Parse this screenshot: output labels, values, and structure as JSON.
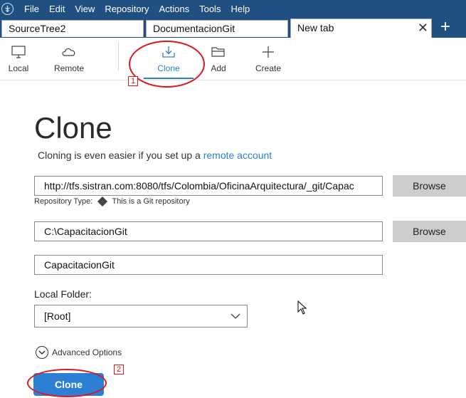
{
  "menu": {
    "items": [
      "File",
      "Edit",
      "View",
      "Repository",
      "Actions",
      "Tools",
      "Help"
    ]
  },
  "tabs": [
    {
      "label": "SourceTree2"
    },
    {
      "label": "DocumentacionGit"
    },
    {
      "label": "New tab",
      "close": "✕"
    }
  ],
  "new_tab_symbol": "+",
  "toolbar": {
    "local": "Local",
    "remote": "Remote",
    "clone": "Clone",
    "add": "Add",
    "create": "Create"
  },
  "annotations": {
    "one": "1",
    "two": "2",
    "color": "#e0161d"
  },
  "page": {
    "title": "Clone",
    "subtitle_prefix": "Cloning is even easier if you set up a ",
    "subtitle_link": "remote account"
  },
  "form": {
    "source_url": "http://tfs.sistran.com:8080/tfs/Colombia/OficinaArquitectura/_git/Capac",
    "browse_label": "Browse",
    "repo_type_label": "Repository Type:",
    "repo_type_value": "This is a Git repository",
    "destination_path": "C:\\CapacitacionGit",
    "name": "CapacitacionGit",
    "local_folder_label": "Local Folder:",
    "local_folder_value": "[Root]",
    "advanced_options": "Advanced Options",
    "clone_button": "Clone"
  },
  "colors": {
    "menubar": "#205081",
    "accent": "#2d7fd3",
    "browse_bg": "#cdcdcd"
  }
}
